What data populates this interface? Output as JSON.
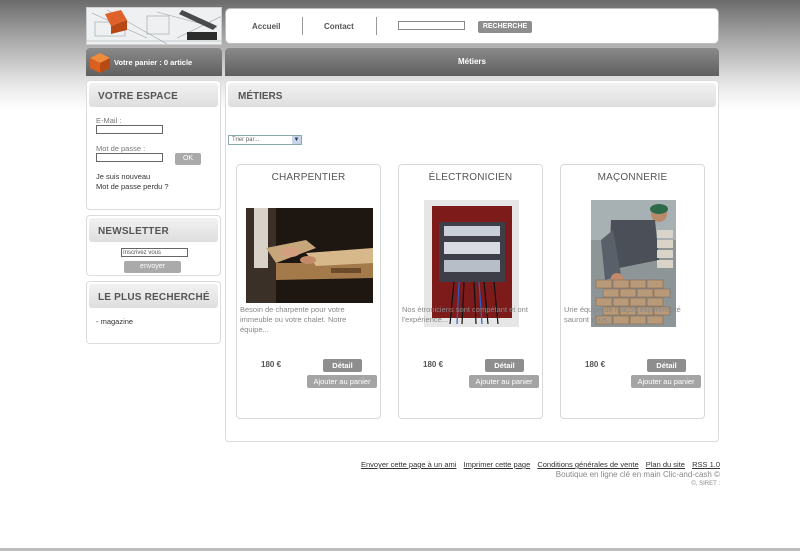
{
  "header": {
    "nav": [
      {
        "label": "Accueil"
      },
      {
        "label": "Contact"
      }
    ],
    "search": {
      "value": "",
      "button_label": "RECHERCHE"
    }
  },
  "cart": {
    "label": "Votre panier : 0 article"
  },
  "section_bar": {
    "title": "Métiers"
  },
  "sidebar": {
    "espace": {
      "title": "VOTRE ESPACE",
      "email_label": "E-Mail :",
      "email_value": "",
      "password_label": "Mot de passe :",
      "password_value": "",
      "ok_label": "OK",
      "new_user_link": "Je suis nouveau",
      "forgot_link": "Mot de passe perdu ?"
    },
    "newsletter": {
      "title": "NEWSLETTER",
      "input_value": "Inscrivez vous",
      "button_label": "envoyer"
    },
    "popular": {
      "title": "LE PLUS RECHERCHÉ",
      "items": [
        "- magazine"
      ]
    }
  },
  "main": {
    "title": "MÉTIERS",
    "sort": {
      "selected": "Trier par..."
    },
    "products": [
      {
        "title": "CHARPENTIER",
        "description": "Besoin de charpente pour votre immeuble ou votre chalet. Notre équipe...",
        "price": "180 €",
        "detail_label": "Détail",
        "add_label": "Ajouter au panier"
      },
      {
        "title": "ÉLECTRONICIEN",
        "description": "Nos étroniciens sont compétant et ont l'expérience...",
        "price": "180 €",
        "detail_label": "Détail",
        "add_label": "Ajouter au panier"
      },
      {
        "title": "MAÇONNERIE",
        "description": "Une équipe de maçon expérimenté sauront vous...",
        "price": "180 €",
        "detail_label": "Détail",
        "add_label": "Ajouter au panier"
      }
    ]
  },
  "footer": {
    "links": [
      "Envoyer cette page à un ami",
      "Imprimer cette page",
      "Conditions générales de vente",
      "Plan du site",
      "RSS 1.0"
    ],
    "tagline": "Boutique en ligne clé en main Clic-and-cash ©",
    "legal": "©, SIRET :"
  },
  "colors": {
    "dark_bar": "#707070",
    "button_grey": "#8e8e8e",
    "text": "#555555"
  }
}
